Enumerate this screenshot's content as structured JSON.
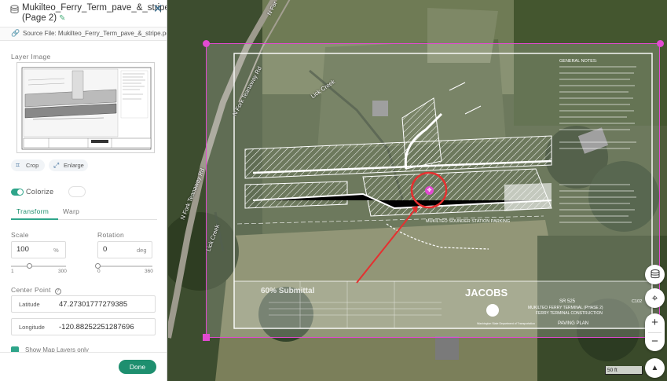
{
  "header": {
    "title": "Mukilteo_Ferry_Term_pave_&_stripe.pdf (Page 2)",
    "source_label": "Source File: Mukilteo_Ferry_Term_pave_&_stripe.pdf"
  },
  "layer_image": {
    "label": "Layer Image",
    "crop_label": "Crop",
    "enlarge_label": "Enlarge"
  },
  "colorize": {
    "label": "Colorize",
    "enabled": true
  },
  "tabs": [
    {
      "label": "Transform",
      "active": true
    },
    {
      "label": "Warp",
      "active": false
    }
  ],
  "scale": {
    "label": "Scale",
    "value": "100",
    "unit": "%",
    "min": "1",
    "max": "300",
    "fraction": 0.33
  },
  "rotation": {
    "label": "Rotation",
    "value": "0",
    "unit": "deg",
    "min": "0",
    "max": "360",
    "fraction": 0.0
  },
  "center_point": {
    "label": "Center Point",
    "latitude_label": "Latitude",
    "latitude": "47.27301777279385",
    "longitude_label": "Longitude",
    "longitude": "-120.88252251287696"
  },
  "show_map_layers": {
    "label": "Show Map Layers only",
    "checked": true
  },
  "done_label": "Done",
  "map": {
    "road_labels": [
      "N Fork Teanaway Rd",
      "N Fork Teanaway Rd",
      "N Fork Teanaway Rd",
      "N For",
      "Lick Creek",
      "Lick Creek"
    ],
    "scale_label": "50 ft",
    "drawing": {
      "general_notes": "GENERAL NOTES:",
      "submittal": "60% Submittal",
      "firm": "JACOBS",
      "station": "MUKILTEO SOUNDER STATION PARKING",
      "sheet_route": "SR 525",
      "sheet_title1": "MUKILTEO FERRY TERMINAL (PHASE 2)",
      "sheet_title2": "FERRY TERMINAL CONSTRUCTION",
      "sheet_title3": "PAVING PLAN",
      "agency": "Washington State Department of Transportation",
      "sheet_no": "C102"
    }
  },
  "colors": {
    "accent": "#2ea58a",
    "done": "#1e8f6f",
    "handle": "#e24ad1",
    "annotation": "#e53030"
  }
}
